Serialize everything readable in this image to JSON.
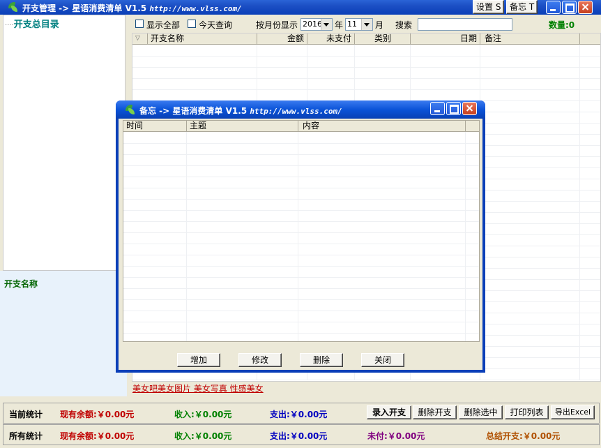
{
  "main_window": {
    "title": "开支管理 -> 星语消费清单 V1.5",
    "url": "http://www.vlss.com/",
    "settings_button": "设置 S",
    "memo_button": "备忘 T"
  },
  "sidebar": {
    "tree_root": "开支总目录",
    "detail_label": "开支名称"
  },
  "filter_bar": {
    "show_all_label": "显示全部",
    "today_label": "今天查询",
    "month_label": "按月份显示",
    "year_value": "2016",
    "year_unit": "年",
    "month_value": "11",
    "month_unit": "月",
    "search_label": "搜索",
    "search_value": "",
    "count_text": "数量:0"
  },
  "expense_table": {
    "columns": [
      "开支名称",
      "金额",
      "未支付",
      "类别",
      "日期",
      "备注"
    ],
    "rows": []
  },
  "ad_link": "美女吧美女图片 美女写真 性感美女",
  "stats_current": {
    "title": "当前统计",
    "balance": "现有余额:￥0.00元",
    "income": "收入:￥0.00元",
    "expense": "支出:￥0.00元"
  },
  "stats_all": {
    "title": "所有统计",
    "balance": "现有余额:￥0.00元",
    "income": "收入:￥0.00元",
    "expense": "支出:￥0.00元",
    "unpaid": "未付:￥0.00元",
    "total": "总结开支:￥0.00元"
  },
  "actions": {
    "add_expense": "录入开支",
    "delete_expense": "删除开支",
    "delete_selected": "删除选中",
    "print_list": "打印列表",
    "export_excel": "导出Excel"
  },
  "memo_dialog": {
    "title": "备忘 -> 星语消费清单 V1.5",
    "url": "http://www.vlss.com/",
    "columns": [
      "时间",
      "主题",
      "内容"
    ],
    "rows": [],
    "add_button": "增加",
    "edit_button": "修改",
    "delete_button": "删除",
    "close_button": "关闭"
  },
  "colors": {
    "title_blue": "#0a3fb8",
    "tree_root_teal": "#008080",
    "balance_red": "#c00000",
    "income_green": "#008000",
    "expense_blue": "#0000c0",
    "unpaid_purple": "#800080",
    "total_orange": "#b05000"
  }
}
